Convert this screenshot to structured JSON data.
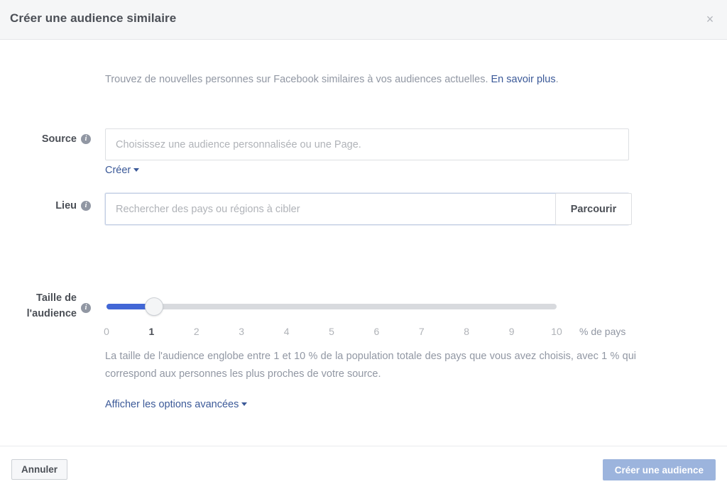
{
  "header": {
    "title": "Créer une audience similaire",
    "close_label": "×"
  },
  "intro": {
    "text": "Trouvez de nouvelles personnes sur Facebook similaires à vos audiences actuelles. ",
    "link": "En savoir plus",
    "period": "."
  },
  "source": {
    "label": "Source",
    "info": "i",
    "placeholder": "Choisissez une audience personnalisée ou une Page.",
    "value": "",
    "create_link": "Créer"
  },
  "location": {
    "label": "Lieu",
    "info": "i",
    "placeholder": "Rechercher des pays ou régions à cibler",
    "value": "",
    "browse_label": "Parcourir"
  },
  "audience_size": {
    "label_line1": "Taille de",
    "label_line2": "l'audience",
    "info": "i",
    "value": 1,
    "min": 0,
    "max": 10,
    "ticks": [
      "0",
      "1",
      "2",
      "3",
      "4",
      "5",
      "6",
      "7",
      "8",
      "9",
      "10"
    ],
    "unit": "% de pays",
    "description": "La taille de l'audience englobe entre 1 et 10 % de la population totale des pays que vous avez choisis, avec 1 % qui correspond aux personnes les plus proches de votre source."
  },
  "advanced": {
    "label": "Afficher les options avancées"
  },
  "footer": {
    "cancel_label": "Annuler",
    "submit_label": "Créer une audience"
  },
  "colors": {
    "accent": "#3b5998",
    "slider_fill": "#4267d6",
    "submit_disabled": "#9cb4dd",
    "header_bg": "#f5f6f7",
    "muted_text": "#9197a3"
  }
}
